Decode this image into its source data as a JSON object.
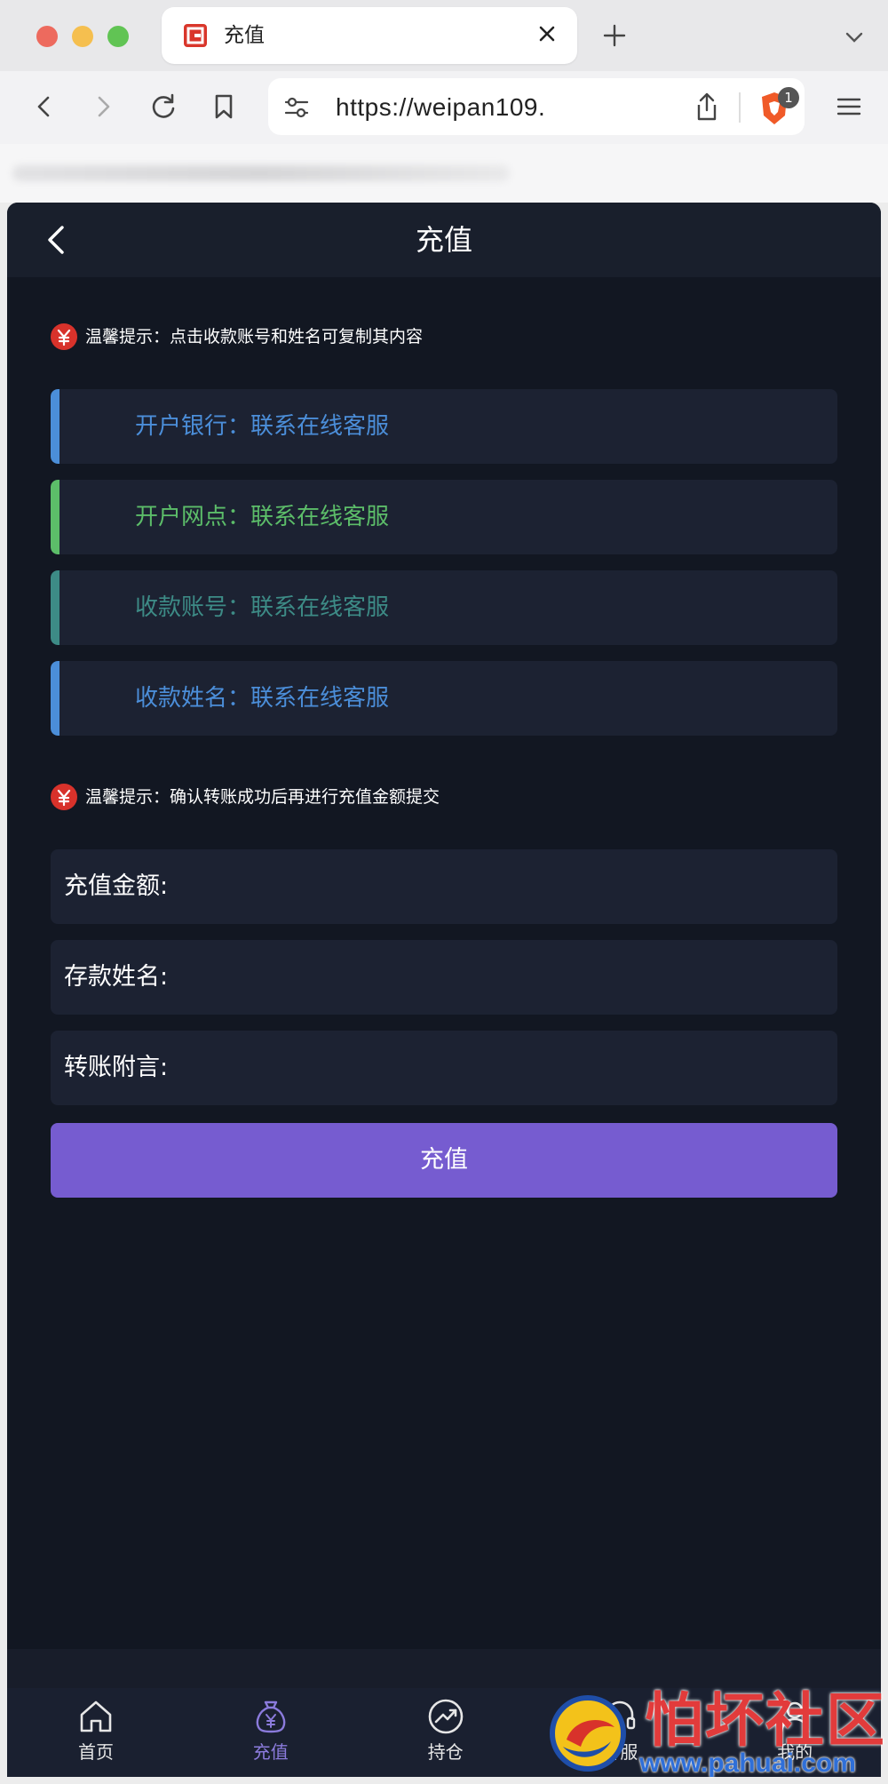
{
  "browser": {
    "tab_title": "充值",
    "url": "https://weipan109.",
    "shield_count": "1"
  },
  "app": {
    "title": "充值",
    "notice1": "温馨提示：点击收款账号和姓名可复制其内容",
    "notice2": "温馨提示：确认转账成功后再进行充值金额提交",
    "bank_rows": [
      {
        "label": "开户银行：联系在线客服",
        "color": "#4b8ed9"
      },
      {
        "label": "开户网点：联系在线客服",
        "color": "#5cbd69"
      },
      {
        "label": "收款账号：联系在线客服",
        "color": "#3d8b86"
      },
      {
        "label": "收款姓名：联系在线客服",
        "color": "#4b8ed9"
      }
    ],
    "fields": [
      {
        "label": "充值金额:",
        "value": ""
      },
      {
        "label": "存款姓名:",
        "value": ""
      },
      {
        "label": "转账附言:",
        "value": ""
      }
    ],
    "submit_label": "充值"
  },
  "bottom_nav": [
    {
      "label": "首页",
      "icon": "home-icon",
      "active": false
    },
    {
      "label": "充值",
      "icon": "money-bag-icon",
      "active": true
    },
    {
      "label": "持仓",
      "icon": "chart-trend-icon",
      "active": false
    },
    {
      "label": "客服",
      "icon": "headset-icon",
      "active": false
    },
    {
      "label": "我的",
      "icon": "user-icon",
      "active": false
    }
  ],
  "watermark": {
    "title": "怕坏社区",
    "url": "www.pahuai.com"
  },
  "colors": {
    "accent": "#765cd0",
    "background": "#121722",
    "card": "#1c2232",
    "nav_active": "#8b7bdc"
  }
}
